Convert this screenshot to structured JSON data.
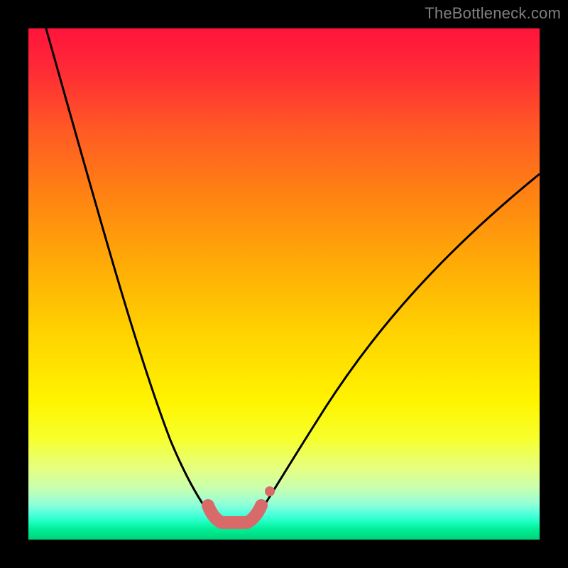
{
  "watermark": "TheBottleneck.com",
  "chart_data": {
    "type": "line",
    "title": "",
    "xlabel": "",
    "ylabel": "",
    "xlim": [
      0,
      100
    ],
    "ylim": [
      0,
      100
    ],
    "background_gradient": {
      "direction": "vertical",
      "stops": [
        {
          "pos": 0.0,
          "color": "#ff143c"
        },
        {
          "pos": 0.6,
          "color": "#ffd400"
        },
        {
          "pos": 0.8,
          "color": "#f7ff2a"
        },
        {
          "pos": 1.0,
          "color": "#00d37a"
        }
      ]
    },
    "series": [
      {
        "name": "bottleneck-curve",
        "stroke": "#000000",
        "x": [
          3,
          8,
          14,
          20,
          26,
          31,
          35,
          36,
          40,
          42,
          44,
          46,
          50,
          56,
          64,
          74,
          86,
          100
        ],
        "y": [
          100,
          80,
          62,
          46,
          30,
          17,
          6,
          4,
          2,
          2,
          4,
          6,
          14,
          26,
          40,
          54,
          66,
          72
        ]
      },
      {
        "name": "optimal-range",
        "stroke": "#d86a6a",
        "stroke_width": 18,
        "x": [
          35,
          36,
          38,
          40,
          42,
          44,
          46
        ],
        "y": [
          6,
          4,
          2,
          2,
          2,
          4,
          6
        ]
      }
    ],
    "markers": [
      {
        "name": "outlier",
        "x": 47,
        "y": 9,
        "color": "#d86a6a",
        "r": 7
      }
    ]
  }
}
